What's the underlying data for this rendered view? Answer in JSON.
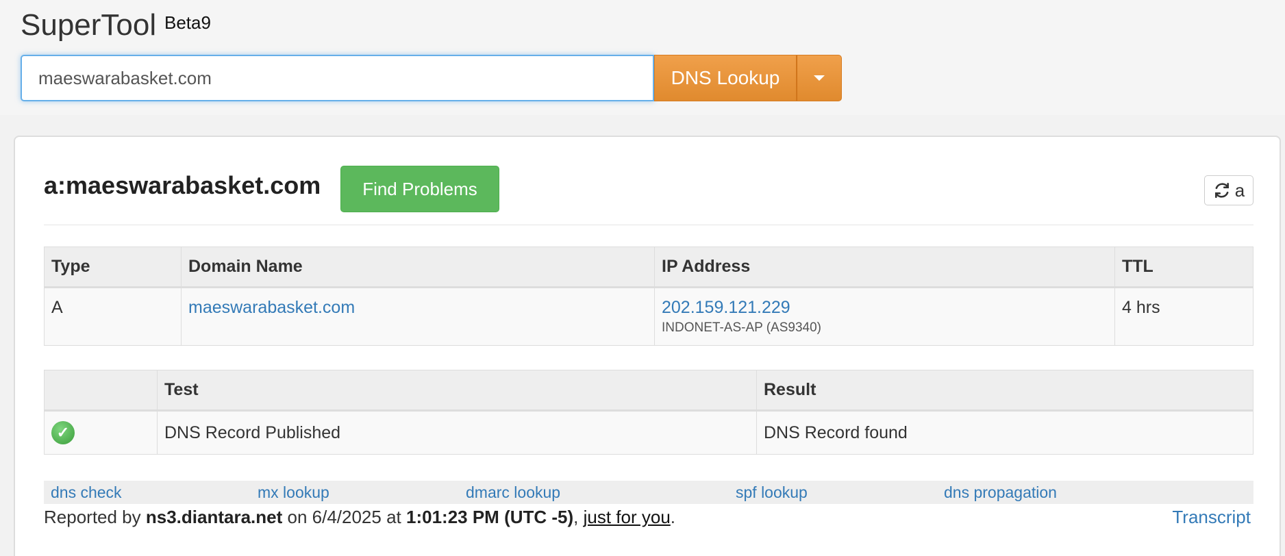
{
  "app": {
    "title": "SuperTool",
    "badge": "Beta9"
  },
  "search": {
    "value": "maeswarabasket.com",
    "button_label": "DNS Lookup"
  },
  "result": {
    "title": "a:maeswarabasket.com",
    "find_problems_label": "Find Problems",
    "refresh_label": "a"
  },
  "dns_table": {
    "headers": [
      "Type",
      "Domain Name",
      "IP Address",
      "TTL"
    ],
    "rows": [
      {
        "type": "A",
        "domain": "maeswarabasket.com",
        "ip": "202.159.121.229",
        "asn": "INDONET-AS-AP (AS9340)",
        "ttl": "4 hrs"
      }
    ]
  },
  "test_table": {
    "headers": [
      "",
      "Test",
      "Result"
    ],
    "rows": [
      {
        "status_icon": "check-circle-icon",
        "test": "DNS Record Published",
        "result": "DNS Record found"
      }
    ]
  },
  "links": [
    "dns check",
    "mx lookup",
    "dmarc lookup",
    "spf lookup",
    "dns propagation"
  ],
  "report": {
    "prefix": "Reported by ",
    "server": "ns3.diantara.net",
    "on": " on 6/4/2025 at ",
    "time": "1:01:23 PM (UTC -5)",
    "sep": ", ",
    "link": "just for you",
    "suffix": "."
  },
  "transcript_label": "Transcript",
  "colors": {
    "accent_orange": "#e8902f",
    "success_green": "#5cb85c",
    "link_blue": "#337ab7"
  }
}
